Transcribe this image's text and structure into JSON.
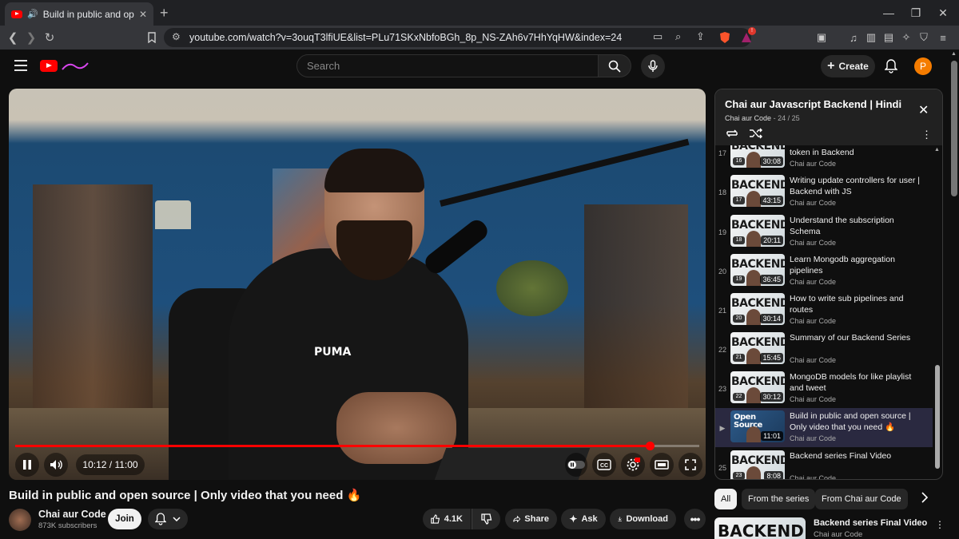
{
  "browser": {
    "tab_title": "Build in public and open sour",
    "new_tab": "+",
    "url": "youtube.com/watch?v=3ouqT3lfiUE&list=PLu71SKxNbfoBGh_8p_NS-ZAh6v7HhYqHW&index=24",
    "brave_badge": "!"
  },
  "header": {
    "search_placeholder": "Search",
    "create_label": "Create",
    "avatar_letter": "P"
  },
  "player": {
    "time_label": "10:12 / 11:00",
    "progress_fraction": 0.927
  },
  "video": {
    "title": "Build in public and open source | Only video that you need 🔥",
    "channel": "Chai aur Code",
    "subscribers": "873K subscribers",
    "join_label": "Join",
    "like_count": "4.1K",
    "share_label": "Share",
    "ask_label": "Ask",
    "download_label": "Download"
  },
  "playlist": {
    "title": "Chai aur Javascript Backend | Hindi",
    "channel": "Chai aur Code",
    "position": "24 / 25",
    "items": [
      {
        "num": "17",
        "title": "token in Backend",
        "channel": "Chai aur Code",
        "duration": "30:08",
        "ep": "16"
      },
      {
        "num": "18",
        "title": "Writing update controllers for user | Backend with JS",
        "channel": "Chai aur Code",
        "duration": "43:15",
        "ep": "17"
      },
      {
        "num": "19",
        "title": "Understand the subscription Schema",
        "channel": "Chai aur Code",
        "duration": "20:11",
        "ep": "18"
      },
      {
        "num": "20",
        "title": "Learn Mongodb aggregation pipelines",
        "channel": "Chai aur Code",
        "duration": "36:45",
        "ep": "19"
      },
      {
        "num": "21",
        "title": "How to write sub pipelines and routes",
        "channel": "Chai aur Code",
        "duration": "30:14",
        "ep": "20"
      },
      {
        "num": "22",
        "title": "Summary of our Backend Series",
        "channel": "Chai aur Code",
        "duration": "15:45",
        "ep": "21"
      },
      {
        "num": "23",
        "title": "MongoDB models for like playlist and tweet",
        "channel": "Chai aur Code",
        "duration": "30:12",
        "ep": "22"
      },
      {
        "num": "▶",
        "title": "Build in public and open source | Only video that you need 🔥",
        "channel": "Chai aur Code",
        "duration": "11:01",
        "ep": "",
        "thumb_text": "Open Source",
        "thumb_sub": "Public"
      },
      {
        "num": "25",
        "title": "Backend series Final Video",
        "channel": "Chai aur Code",
        "duration": "8:08",
        "ep": "23"
      }
    ],
    "thumb_text": "BACKEND"
  },
  "chips": [
    "All",
    "From the series",
    "From Chai aur Code"
  ],
  "recommended": {
    "thumb_text": "BACKEND",
    "title": "Backend series Final Video",
    "channel": "Chai aur Code"
  },
  "colors": {
    "accent": "#ff0000",
    "avatar": "#f57c00",
    "active_row": "#2a2940"
  }
}
